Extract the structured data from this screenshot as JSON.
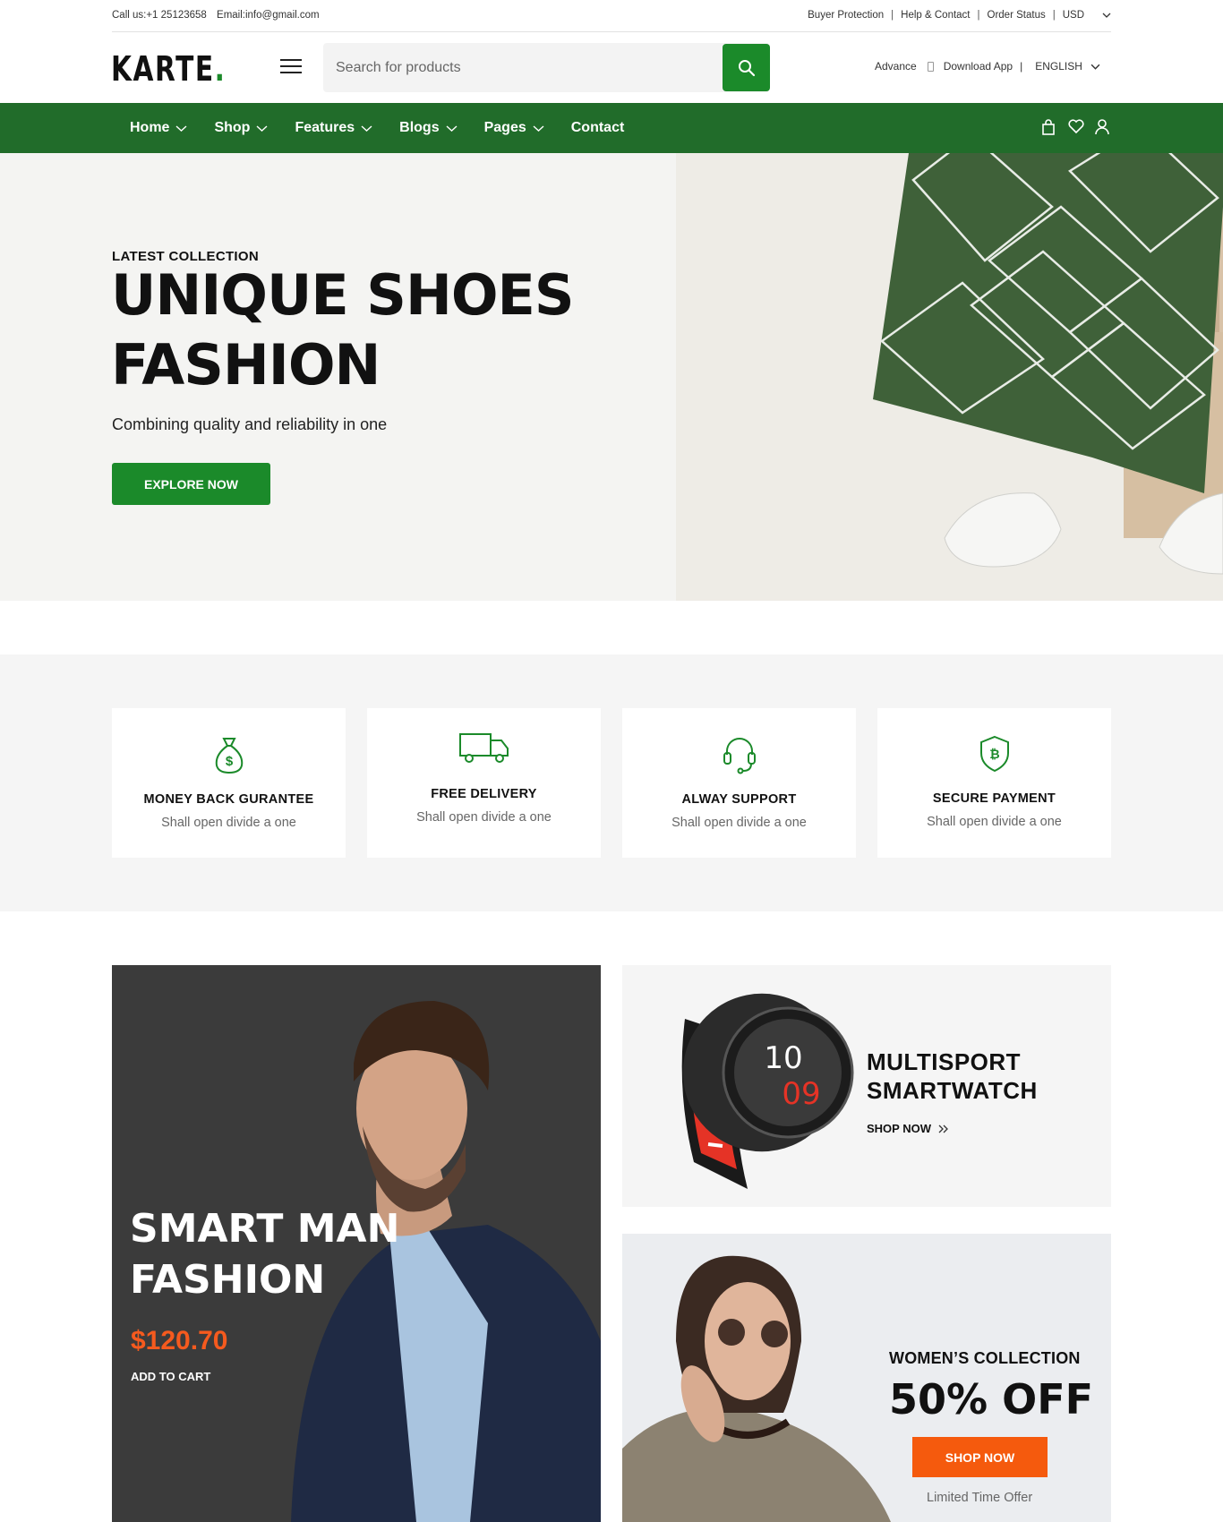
{
  "topbar": {
    "call": "Call us:+1 25123658",
    "email": "Email:info@gmail.com",
    "links": [
      "Buyer Protection",
      "Help & Contact",
      "Order Status"
    ],
    "currency": "USD"
  },
  "header": {
    "logo": "KARTE",
    "logo_dot": ".",
    "search_placeholder": "Search for products",
    "advance": "Advance",
    "download_app": "Download App",
    "language": "ENGLISH"
  },
  "nav": {
    "items": [
      "Home",
      "Shop",
      "Features",
      "Blogs",
      "Pages",
      "Contact"
    ]
  },
  "hero": {
    "kicker": "LATEST COLLECTION",
    "title_line1": "UNIQUE SHOES",
    "title_line2": "FASHION",
    "subtitle": "Combining quality and reliability in one",
    "button": "EXPLORE NOW"
  },
  "features": [
    {
      "title": "MONEY BACK GURANTEE",
      "text": "Shall open divide a one",
      "icon": "money-bag-icon"
    },
    {
      "title": "FREE DELIVERY",
      "text": "Shall open divide a one",
      "icon": "truck-icon"
    },
    {
      "title": "ALWAY SUPPORT",
      "text": "Shall open divide a one",
      "icon": "headset-icon"
    },
    {
      "title": "SECURE PAYMENT",
      "text": "Shall open divide a one",
      "icon": "shield-icon"
    }
  ],
  "banners": {
    "man": {
      "title_line1": "SMART MAN",
      "title_line2": "FASHION",
      "price": "$120.70",
      "cta": "ADD TO CART"
    },
    "watch": {
      "title_line1": "MULTISPORT",
      "title_line2": "SMARTWATCH",
      "cta": "SHOP NOW"
    },
    "women": {
      "kicker": "WOMEN’S COLLECTION",
      "offer": "50% OFF",
      "cta": "SHOP NOW",
      "note": "Limited Time Offer"
    }
  },
  "colors": {
    "brand_green": "#1b8a2a",
    "nav_green": "#216c2a",
    "accent_orange": "#f55a1e"
  }
}
